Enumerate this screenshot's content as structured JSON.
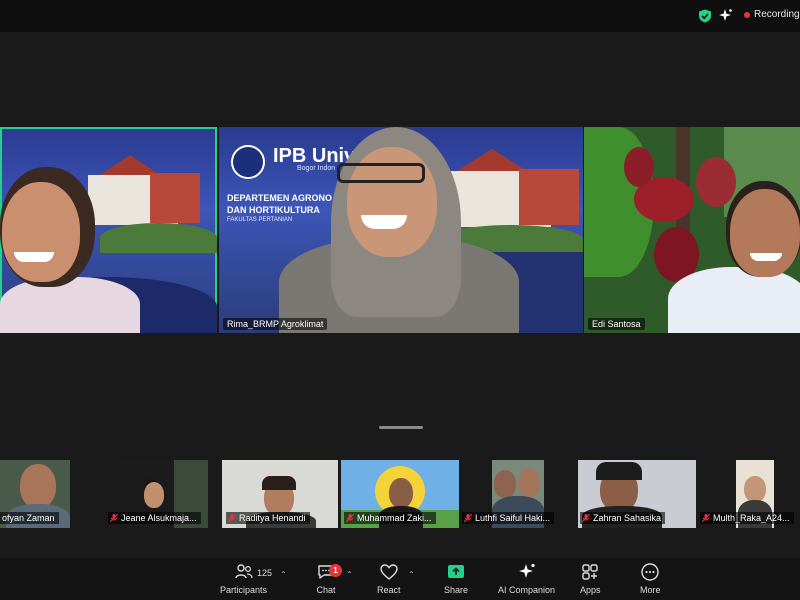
{
  "top_bar": {
    "recording_label": "Recording",
    "icons": [
      "shield-check-icon",
      "sparkle-icon",
      "record-dot-icon"
    ],
    "shield_color": "#23d18b",
    "record_color": "#e8333a"
  },
  "main_tiles": [
    {
      "name": "",
      "active": true
    },
    {
      "name": "Rima_BRMP Agroklimat",
      "slide": {
        "title": "IPB Univ",
        "subtitle": "Bogor Indon",
        "dept_line1": "DEPARTEMEN AGRONO",
        "dept_line2": "DAN HORTIKULTURA",
        "dept_line3": "FAKULTAS PERTANIAN"
      }
    },
    {
      "name": "Edi Santosa"
    }
  ],
  "thumbnails": [
    {
      "name": "ofyan Zaman",
      "muted": false
    },
    {
      "name": "Jeane Alsukmaja...",
      "muted": true
    },
    {
      "name": "Raditya Henandi",
      "muted": true
    },
    {
      "name": "Muhammad Zaki...",
      "muted": true
    },
    {
      "name": "Luthfi Saiful Haki...",
      "muted": true
    },
    {
      "name": "Zahran Sahasika",
      "muted": true
    },
    {
      "name": "Multh_Raka_A24...",
      "muted": true
    }
  ],
  "toolbar": {
    "participants_label": "Participants",
    "participants_count": "125",
    "chat_label": "Chat",
    "chat_badge": "1",
    "react_label": "React",
    "share_label": "Share",
    "ai_label": "AI Companion",
    "apps_label": "Apps",
    "more_label": "More",
    "share_color": "#23d18b",
    "accent_active": "#23d18b"
  }
}
